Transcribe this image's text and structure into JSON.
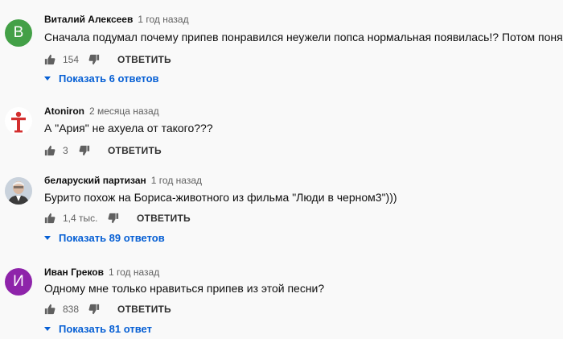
{
  "comments": [
    {
      "avatar_letter": "В",
      "avatar_color": "#43a047",
      "author": "Виталий Алексеев",
      "time": "1 год назад",
      "text": "Сначала подумал почему припев понравился неужели попса нормальная появилась!? Потом понял.....",
      "likes": "154",
      "reply_label": "ОТВЕТИТЬ",
      "replies_label": "Показать 6 ответов"
    },
    {
      "avatar_letter": "T",
      "avatar_color": "#d32f2f",
      "author": "Atoniron",
      "time": "2 месяца назад",
      "text": "А \"Ария\" не ахуела от такого???",
      "likes": "3",
      "reply_label": "ОТВЕТИТЬ"
    },
    {
      "author": "беларуский партизан",
      "time": "1 год назад",
      "text": "Бурито похож на Бориса-животного из фильма \"Люди в черном3\")))",
      "likes": "1,4 тыс.",
      "reply_label": "ОТВЕТИТЬ",
      "replies_label": "Показать 89 ответов"
    },
    {
      "avatar_letter": "И",
      "avatar_color": "#8e24aa",
      "author": "Иван Греков",
      "time": "1 год назад",
      "text": "Одному мне только нравиться припев из этой песни?",
      "likes": "838",
      "reply_label": "ОТВЕТИТЬ",
      "replies_label": "Показать 81 ответ"
    }
  ]
}
